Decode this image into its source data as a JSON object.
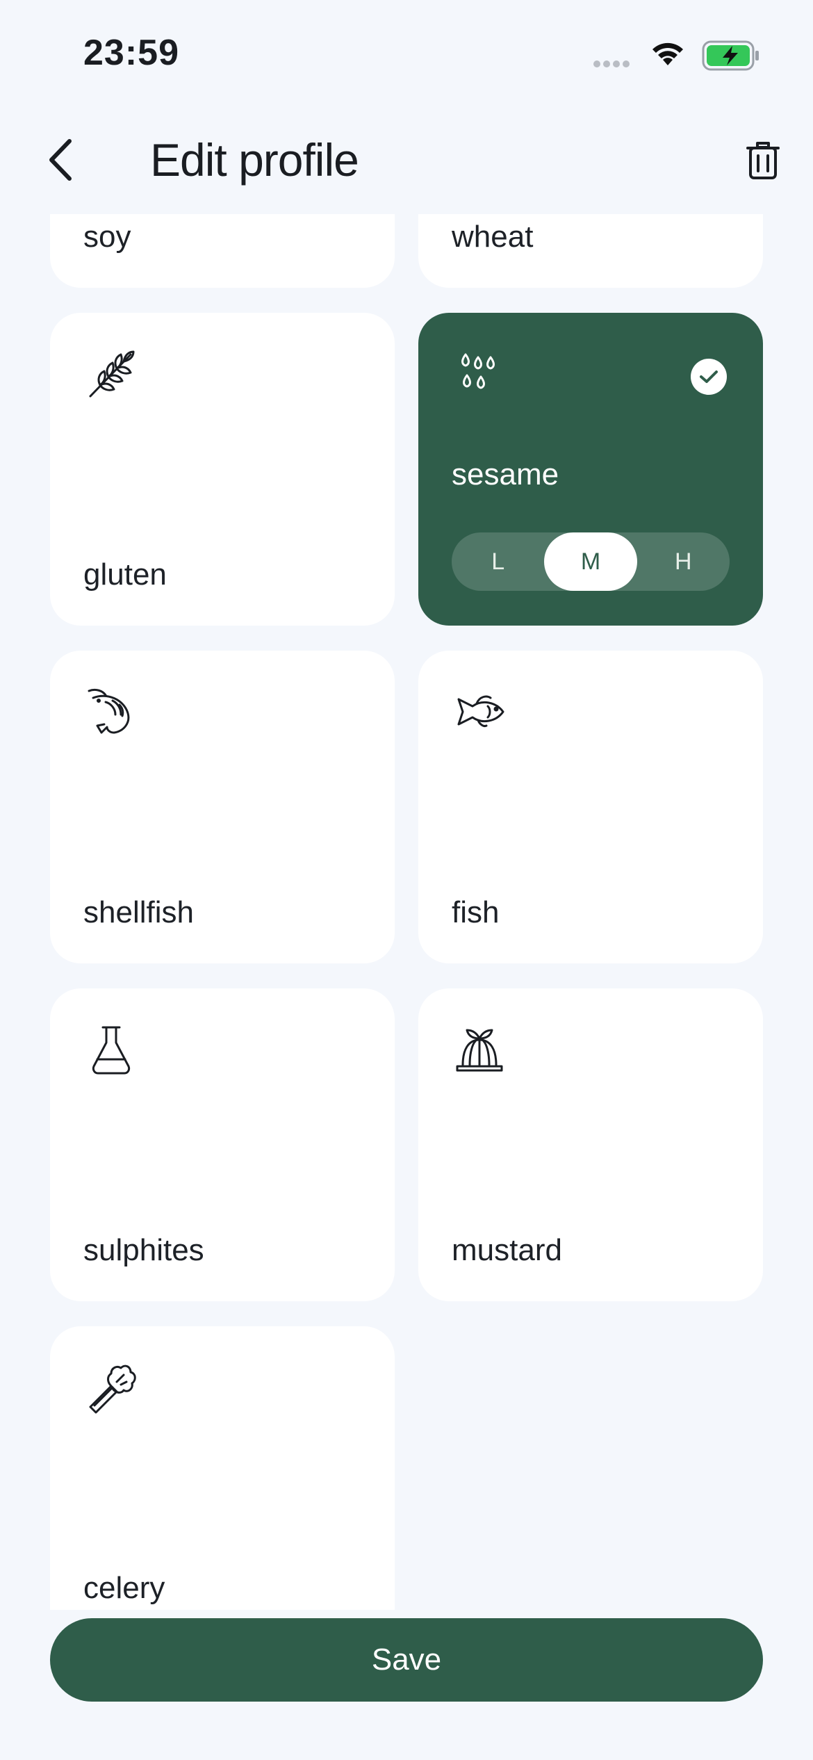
{
  "status": {
    "time": "23:59"
  },
  "header": {
    "title": "Edit profile"
  },
  "allergens": [
    {
      "name": "soy",
      "selected": false
    },
    {
      "name": "wheat",
      "selected": false
    },
    {
      "name": "gluten",
      "icon": "wheat-stalk-icon",
      "selected": false
    },
    {
      "name": "sesame",
      "icon": "seeds-icon",
      "selected": true,
      "levels": [
        "L",
        "M",
        "H"
      ],
      "active_level": "M"
    },
    {
      "name": "shellfish",
      "icon": "shrimp-icon",
      "selected": false
    },
    {
      "name": "fish",
      "icon": "fish-icon",
      "selected": false
    },
    {
      "name": "sulphites",
      "icon": "flask-icon",
      "selected": false
    },
    {
      "name": "mustard",
      "icon": "jelly-mold-icon",
      "selected": false
    },
    {
      "name": "celery",
      "icon": "celery-icon",
      "selected": false
    }
  ],
  "actions": {
    "save_label": "Save"
  },
  "colors": {
    "accent": "#2f5d4a",
    "background": "#f4f7fc",
    "card": "#ffffff"
  }
}
